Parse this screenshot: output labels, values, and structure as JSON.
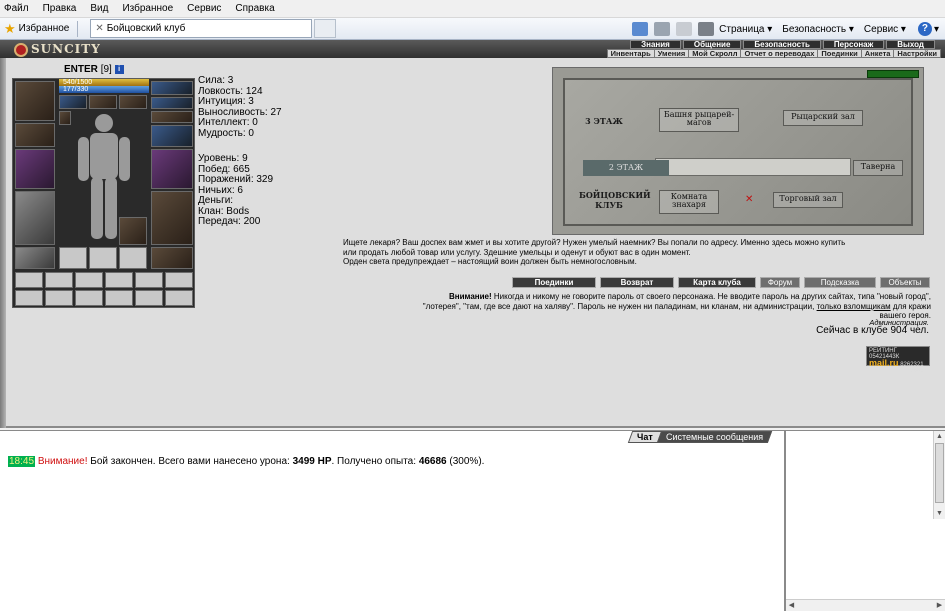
{
  "menu": [
    "Файл",
    "Правка",
    "Вид",
    "Избранное",
    "Сервис",
    "Справка"
  ],
  "favbar": {
    "favorites": "Избранное",
    "tab_title": "Бойцовский клуб",
    "page": "Страница",
    "safety": "Безопасность",
    "service": "Сервис"
  },
  "game": {
    "logo": "SUNCITY",
    "topnav": [
      "Знания",
      "Общение",
      "Безопасность",
      "Персонаж",
      "Выход"
    ],
    "subnav": [
      "Инвентарь",
      "Умения",
      "Мой Скролл",
      "Отчет о переводах",
      "Поединки",
      "Анкета",
      "Настройки"
    ]
  },
  "character": {
    "name": "ENTER",
    "level": "[9]",
    "badge": "i",
    "hp": "540/1500",
    "mp": "177/330"
  },
  "stats": [
    "Сила: 3",
    "Ловкость: 124",
    "Интуиция: 3",
    "Выносливость: 27",
    "Интеллект: 0",
    "Мудрость: 0"
  ],
  "stats2": [
    "Уровень: 9",
    "Побед: 665",
    "Поражений: 329",
    "Ничьих: 6",
    "Деньги:",
    "Клан: Bods",
    "Передач: 200"
  ],
  "map": {
    "floor3": "3 ЭТАЖ",
    "floor2": "2 ЭТАЖ",
    "club": "БОЙЦОВСКИЙ КЛУБ",
    "rooms": {
      "mages": "Башня рыцарей-магов",
      "knights": "Рыцарский зал",
      "tavern": "Таверна",
      "healer": "Комната знахаря",
      "trade": "Торговый зал"
    }
  },
  "desc": [
    "Ищете лекаря? Ваш доспех вам жмет и вы хотите другой? Нужен умелый наемник? Вы попали по адресу. Именно здесь можно купить",
    "или продать любой товар или услугу. Здешние умельцы и оденут и обуют вас в один момент.",
    "Орден света предупреждает – настоящий воин должен быть немногословным."
  ],
  "buttons": {
    "duels": "Поединки",
    "back": "Возврат",
    "map": "Карта клуба",
    "forum": "Форум",
    "hint": "Подсказка",
    "objects": "Объекты"
  },
  "warning": {
    "title": "Внимание!",
    "line1": "Никогда и никому не говорите пароль от своего персонажа. Не вводите пароль на других сайтах, типа \"новый город\",",
    "line2": "\"лотерея\", \"там, где все дают на халяву\". Пароль не нужен ни паладинам, ни кланам, ни администрации,",
    "link": "только взломщикам",
    "line2_end": "для кражи",
    "line3": "вашего героя."
  },
  "admin": "Администрация.",
  "online": "Сейчас в клубе 904 чел.",
  "rating": {
    "title": "РЕЙТИНГ",
    "n1": "05421443К",
    "brand": "mail.ru",
    "n2": "8262321",
    "n3": "28067"
  },
  "chat": {
    "tab_chat": "Чат",
    "tab_system": "Системные сообщения",
    "time": "18:45",
    "alert": "Внимание!",
    "text1": "Бой закончен. Всего вами нанесено урона:",
    "damage": "3499 HP",
    "text2": ". Получено опыта:",
    "exp": "46686",
    "pct": "(300%)."
  }
}
